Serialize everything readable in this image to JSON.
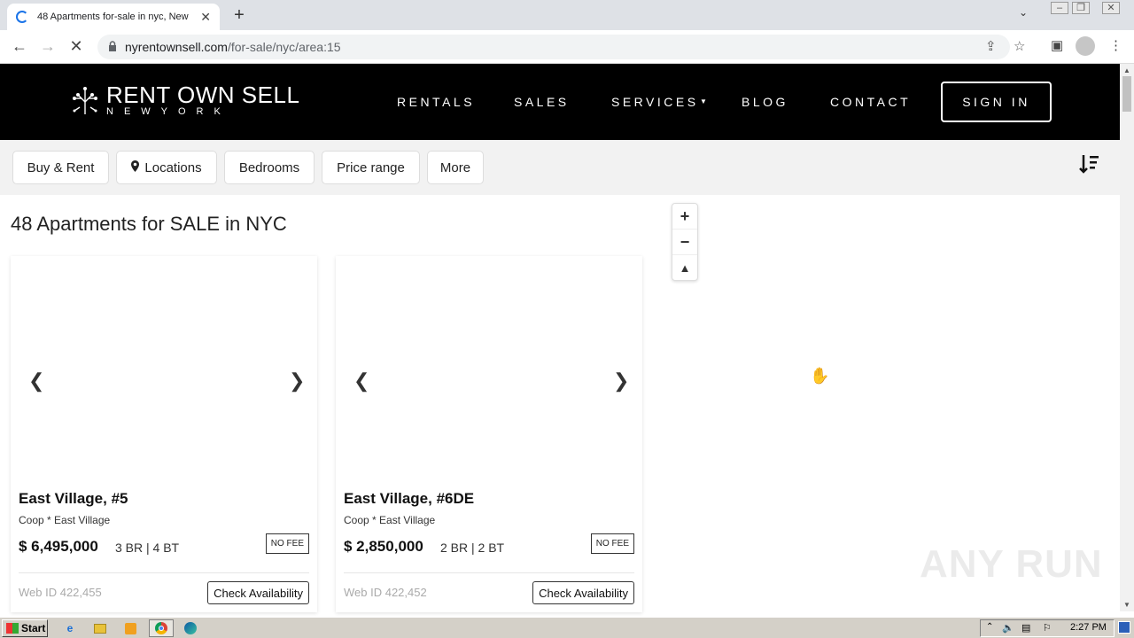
{
  "browser": {
    "tab_title": "48 Apartments for-sale in nyc, New",
    "url_domain": "nyrentownsell.com",
    "url_path": "/for-sale/nyc/area:15"
  },
  "site": {
    "logo_line1": "RENT OWN SELL",
    "logo_line2": "NEWYORK",
    "nav": [
      "RENTALS",
      "SALES",
      "SERVICES",
      "BLOG",
      "CONTACT"
    ],
    "signin": "SIGN IN"
  },
  "filters": [
    "Buy & Rent",
    "Locations",
    "Bedrooms",
    "Price range",
    "More"
  ],
  "results_title": "48 Apartments for SALE in NYC",
  "listings": [
    {
      "title": "East Village, #5",
      "subtitle": "Coop * East Village",
      "price": "$ 6,495,000",
      "beds": "3 BR | 4 BT",
      "badge": "NO FEE",
      "web_id": "Web ID 422,455",
      "cta": "Check Availability"
    },
    {
      "title": "East Village, #6DE",
      "subtitle": "Coop * East Village",
      "price": "$ 2,850,000",
      "beds": "2 BR | 2 BT",
      "badge": "NO FEE",
      "web_id": "Web ID 422,452",
      "cta": "Check Availability"
    }
  ],
  "map": {
    "zoom_in": "+",
    "zoom_out": "−",
    "compass": "▲"
  },
  "taskbar": {
    "start": "Start",
    "clock": "2:27 PM"
  },
  "watermark": "ANY RUN"
}
